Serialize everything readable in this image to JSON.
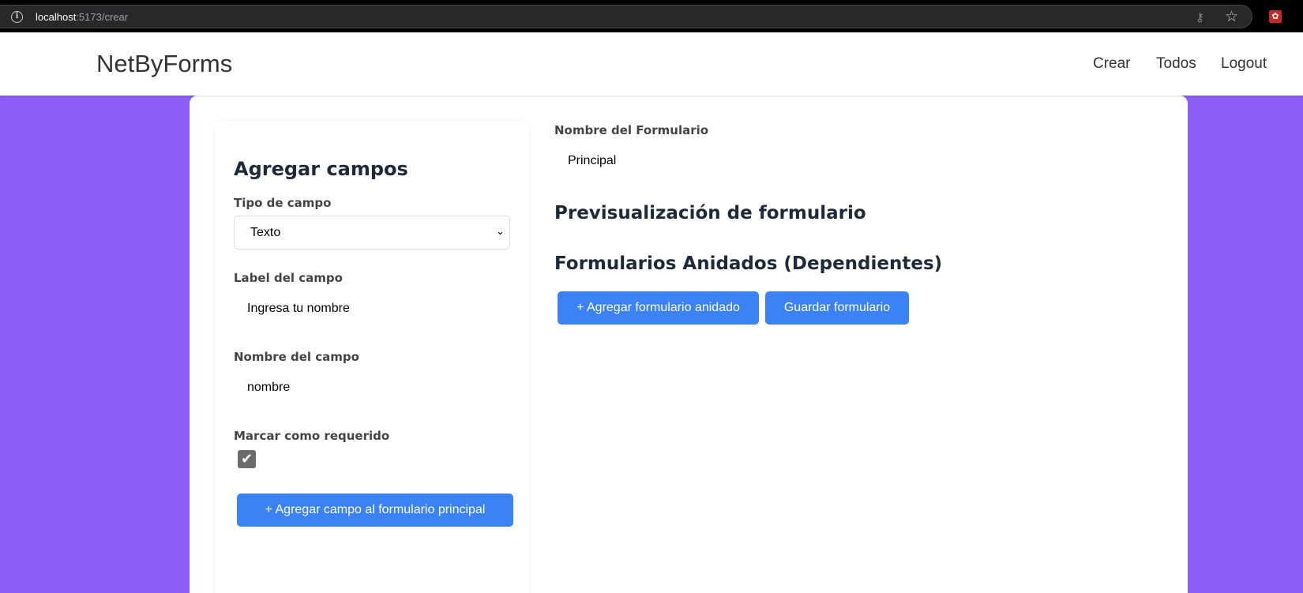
{
  "browser": {
    "url_host": "localhost",
    "url_path": ":5173/crear"
  },
  "navbar": {
    "brand": "NetByForms",
    "links": [
      "Crear",
      "Todos",
      "Logout"
    ]
  },
  "builder": {
    "title": "Agregar campos",
    "type_label": "Tipo de campo",
    "type_value": "Texto",
    "label_label": "Label del campo",
    "label_value": "Ingresa tu nombre",
    "name_label": "Nombre del campo",
    "name_value": "nombre",
    "required_label": "Marcar como requerido",
    "required_checked": true,
    "add_button": "+ Agregar campo al formulario principal"
  },
  "form": {
    "name_label": "Nombre del Formulario",
    "name_value": "Principal",
    "preview_title": "Previsualización de formulario",
    "nested_title": "Formularios Anidados (Dependientes)",
    "add_nested_button": "+ Agregar formulario anidado",
    "save_button": "Guardar formulario"
  },
  "colors": {
    "background": "#8b5cf6",
    "primary_button": "#3b82f6"
  }
}
